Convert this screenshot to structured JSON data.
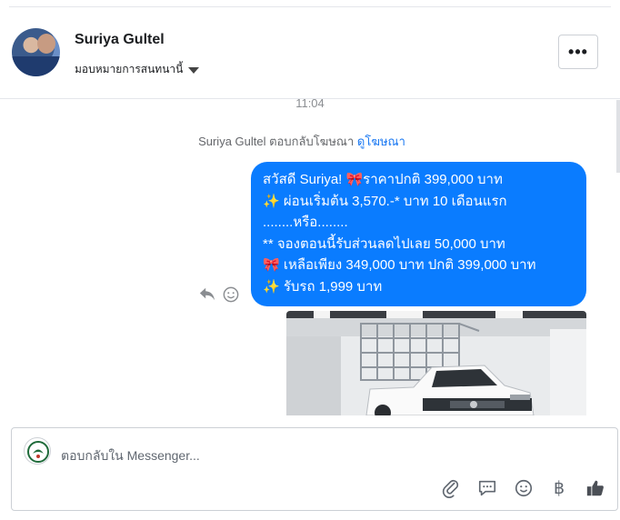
{
  "header": {
    "name": "Suriya Gultel",
    "assign_label": "มอบหมายการสนทนานี้",
    "more_label": "•••"
  },
  "thread": {
    "time": "11:04",
    "replied_text": "Suriya Gultel ตอบกลับโฆษณา",
    "view_ad_link": "ดูโฆษณา",
    "message_lines": [
      "สวัสดี Suriya! 🎀ราคาปกติ 399,000 บาท",
      "✨ ผ่อนเริ่มต้น 3,570.-* บาท 10 เดือนแรก",
      "........หรือ........",
      "** จองตอนนี้รับส่วนลดไปเลย 50,000 บาท",
      "🎀 เหลือเพียง 349,000 บาท ปกติ 399,000 บาท",
      "✨ รับรถ 1,999 บาท"
    ]
  },
  "composer": {
    "placeholder": "ตอบกลับใน Messenger...",
    "icons": [
      "paperclip-icon",
      "speech-bubble-icon",
      "smiley-icon",
      "baht-icon",
      "thumbs-up-icon"
    ],
    "baht_symbol": "฿"
  },
  "colors": {
    "bubble": "#0a7cff",
    "link": "#1877f2",
    "icon_gray": "#606770"
  }
}
